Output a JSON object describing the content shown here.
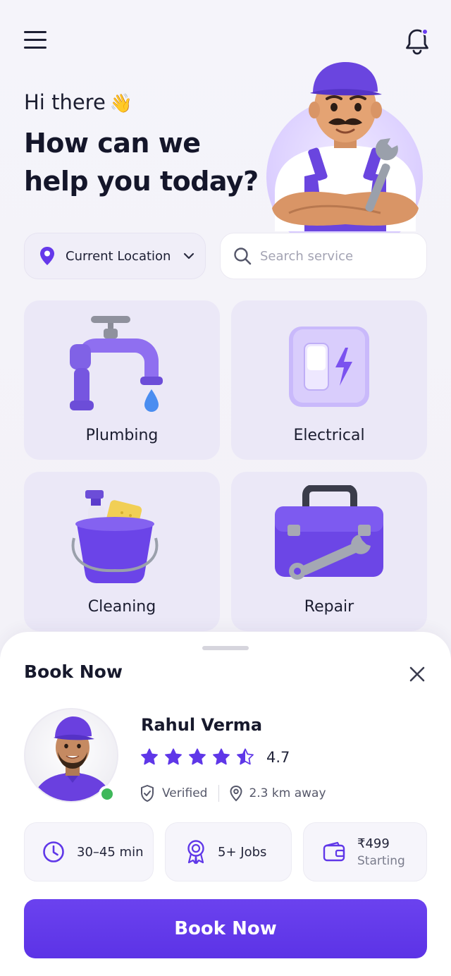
{
  "header": {
    "menu_icon": "hamburger-menu-icon",
    "notification_icon": "bell-icon",
    "notification_badge_color": "#6a3df0"
  },
  "hero": {
    "greeting": "Hi there",
    "greeting_emoji": "👋",
    "headline": "How can we help you today?",
    "illustration": "technician-with-wrench"
  },
  "location": {
    "label": "Current Location",
    "icon": "map-pin-icon"
  },
  "search": {
    "placeholder": "Search service",
    "value": ""
  },
  "services": [
    {
      "label": "Plumbing",
      "icon": "faucet-icon"
    },
    {
      "label": "Electrical",
      "icon": "light-switch-icon"
    },
    {
      "label": "Cleaning",
      "icon": "cleaning-bucket-icon"
    },
    {
      "label": "Repair",
      "icon": "toolbox-icon"
    }
  ],
  "sheet": {
    "title": "Book Now",
    "provider": {
      "name": "Rahul Verma",
      "rating": "4.7",
      "stars_filled": 4.5,
      "stars_max": 5,
      "verified": "Verified",
      "distance": "2.3 km away",
      "online": true
    },
    "stats": {
      "duration": "30–45 min",
      "jobs": "5+ Jobs",
      "price": "₹499",
      "price_note": "Starting"
    },
    "cta": "Book Now"
  },
  "colors": {
    "accent": "#5f37e8",
    "card_bg": "#ebe8f7",
    "online": "#3fb85a"
  }
}
